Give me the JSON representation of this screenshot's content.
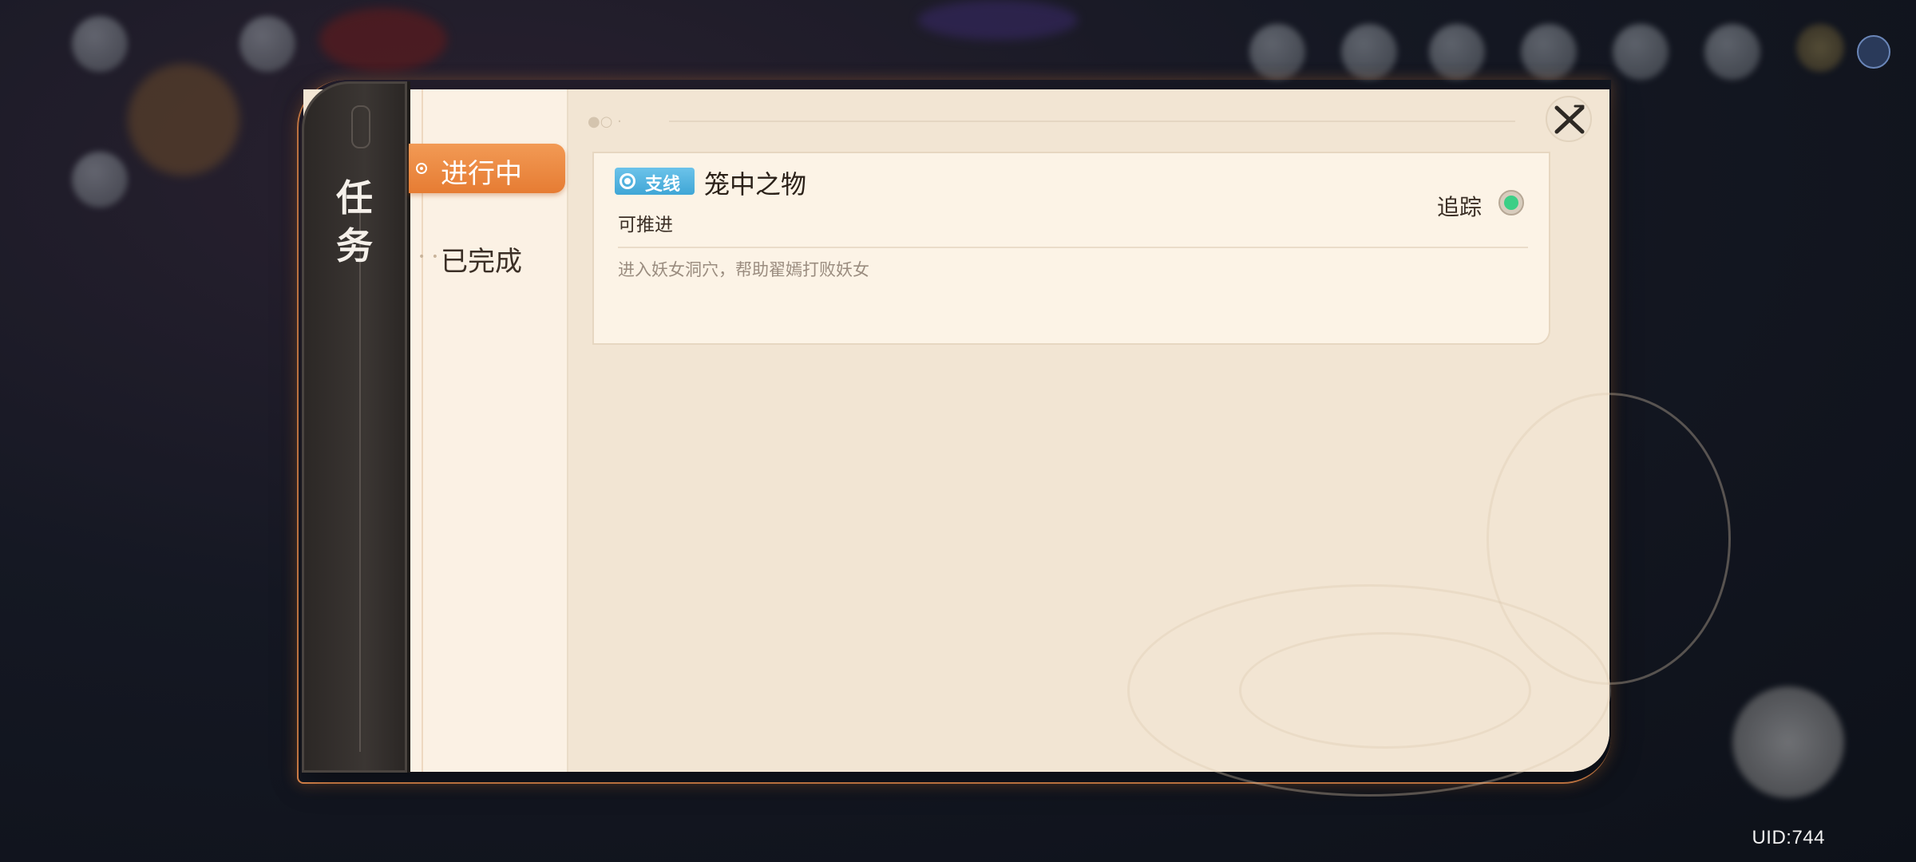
{
  "app": {
    "uid": "UID:744"
  },
  "panel": {
    "title_chars": [
      "任",
      "务"
    ],
    "tabs": [
      {
        "label": "进行中",
        "active": true
      },
      {
        "label": "已完成",
        "active": false
      }
    ],
    "close_icon": "close-x-icon"
  },
  "quest": {
    "badge": "支线",
    "title": "笼中之物",
    "status": "可推进",
    "description": "进入妖女洞穴，帮助翟嫣打败妖女",
    "track_label": "追踪",
    "tracking": true
  },
  "colors": {
    "accent_orange": "#e67c33",
    "badge_blue": "#3fa6d6",
    "track_green": "#3ccf86",
    "panel_bg": "#f3e6d4",
    "spine_dark": "#2b2725"
  }
}
